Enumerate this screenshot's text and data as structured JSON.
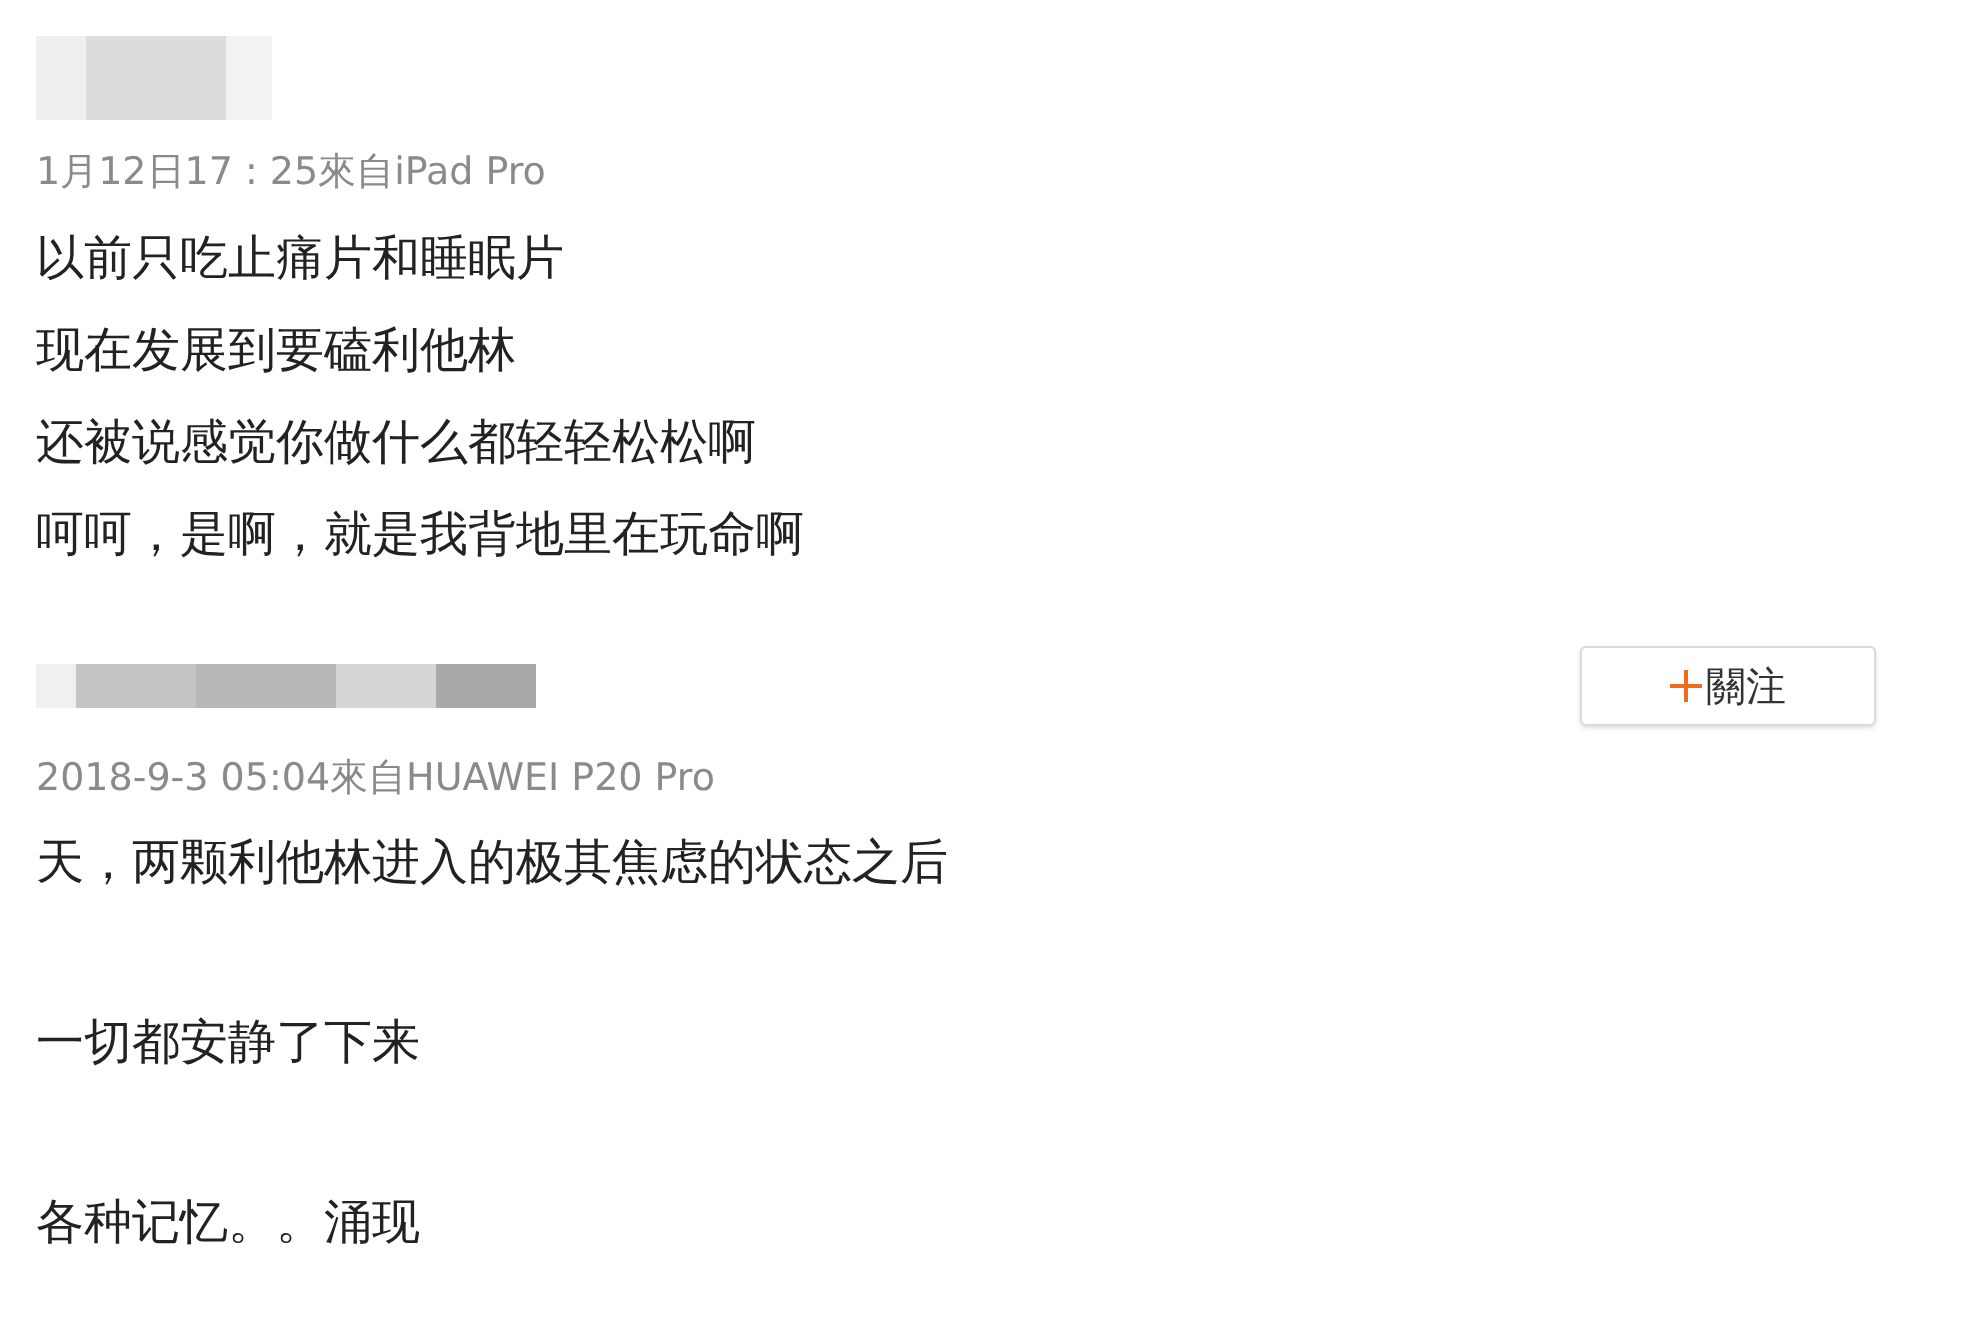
{
  "posts": [
    {
      "kind": "compact",
      "meta": "1月12日17 : 25來自iPad Pro",
      "lines": [
        "以前只吃止痛片和睡眠片",
        "现在发展到要磕利他林",
        "还被说感觉你做什么都轻轻松松啊",
        "呵呵，是啊，就是我背地里在玩命啊"
      ]
    },
    {
      "kind": "spaced",
      "follow_button": {
        "label": "關注"
      },
      "meta": "2018-9-3 05:04來自HUAWEI P20 Pro",
      "lines": [
        "天，两颗利他林进入的极其焦虑的状态之后",
        "一切都安静了下来",
        "各种记忆。。涌现"
      ]
    }
  ]
}
